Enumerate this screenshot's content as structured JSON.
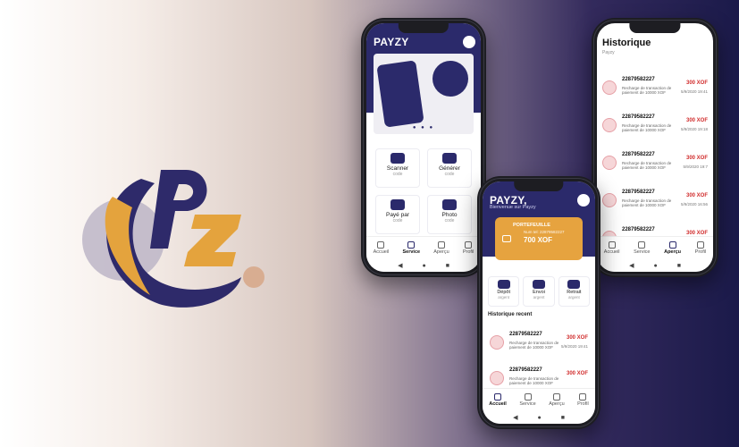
{
  "colors": {
    "navy": "#2b2a6b",
    "orange": "#e4a33d",
    "red": "#d12d2d"
  },
  "logo": {
    "letters": "PZ"
  },
  "phone_service": {
    "brand": "PAYZY",
    "tiles": [
      {
        "title": "Scanner",
        "sub": "code",
        "icon": "qr-scan-icon"
      },
      {
        "title": "Générer",
        "sub": "code",
        "icon": "qr-generate-icon"
      },
      {
        "title": "Payé par",
        "sub": "code",
        "icon": "pay-icon"
      },
      {
        "title": "Photo",
        "sub": "code",
        "icon": "camera-icon"
      }
    ],
    "tabs": [
      "Accueil",
      "Service",
      "Aperçu",
      "Profil"
    ]
  },
  "phone_home": {
    "brand": "PAYZY,",
    "welcome": "Bienvenue sur Payzy",
    "card": {
      "label": "PORTEFEUILLE",
      "number": "Num tel: 22879582227",
      "balance": "700  XOF"
    },
    "actions": [
      {
        "title": "Dépôt",
        "sub": "argent"
      },
      {
        "title": "Envoi",
        "sub": "argent"
      },
      {
        "title": "Retrait",
        "sub": "argent"
      }
    ],
    "section": "Historique recent",
    "transactions": [
      {
        "phone": "22879582227",
        "desc": "Recharge de transaction de paiement de 10000 XOF",
        "amount": "300 XOF",
        "date": "5/9/2020 19:41"
      },
      {
        "phone": "22879582227",
        "desc": "Recharge de transaction de paiement de 10000 XOF",
        "amount": "300 XOF",
        "date": ""
      }
    ],
    "tabs": [
      "Accueil",
      "Service",
      "Aperçu",
      "Profil"
    ]
  },
  "phone_history": {
    "title": "Historique",
    "subtitle": "Payzy",
    "transactions": [
      {
        "phone": "22879582227",
        "desc": "Recharge de transaction de paiement de 10000 XOF",
        "amount": "300 XOF",
        "date": "5/9/2020 19:41"
      },
      {
        "phone": "22879582227",
        "desc": "Recharge de transaction de paiement de 10000 XOF",
        "amount": "300 XOF",
        "date": "5/9/2020 19:18"
      },
      {
        "phone": "22879582227",
        "desc": "Recharge de transaction de paiement de 10000 XOF",
        "amount": "300 XOF",
        "date": "5/9/2020 19:7"
      },
      {
        "phone": "22879582227",
        "desc": "Recharge de transaction de paiement de 10000 XOF",
        "amount": "300 XOF",
        "date": "5/9/2020 16:56"
      },
      {
        "phone": "22879582227",
        "desc": "",
        "amount": "300 XOF",
        "date": ""
      }
    ],
    "tabs": [
      "Accueil",
      "Service",
      "Aperçu",
      "Profil"
    ]
  }
}
